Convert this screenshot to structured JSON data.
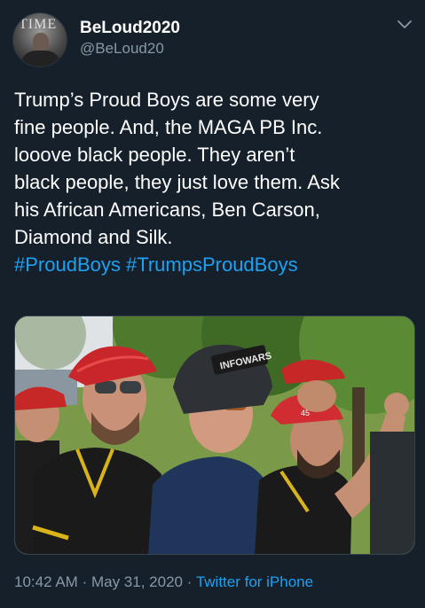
{
  "user": {
    "display_name": "BeLoud2020",
    "handle": "@BeLoud20",
    "avatar_text": "TIME"
  },
  "tweet": {
    "lines": [
      "Trump’s Proud Boys are some very",
      "fine people. And, the MAGA PB Inc.",
      "looove black people. They aren’t",
      "black people, they just love them. Ask",
      "his African Americans, Ben Carson,",
      "Diamond and Silk."
    ],
    "hashtags": [
      "#ProudBoys",
      "#TrumpsProudBoys"
    ]
  },
  "photo": {
    "hat_text": "INFOWARS",
    "number_text": "45"
  },
  "meta": {
    "time": "10:42 AM",
    "separator": "·",
    "date": "May 31, 2020",
    "source": "Twitter for iPhone"
  },
  "colors": {
    "background": "#15202b",
    "text": "#ffffff",
    "muted": "#8899a6",
    "link": "#1da1f2"
  },
  "icons": [
    "chevron-down-icon"
  ]
}
